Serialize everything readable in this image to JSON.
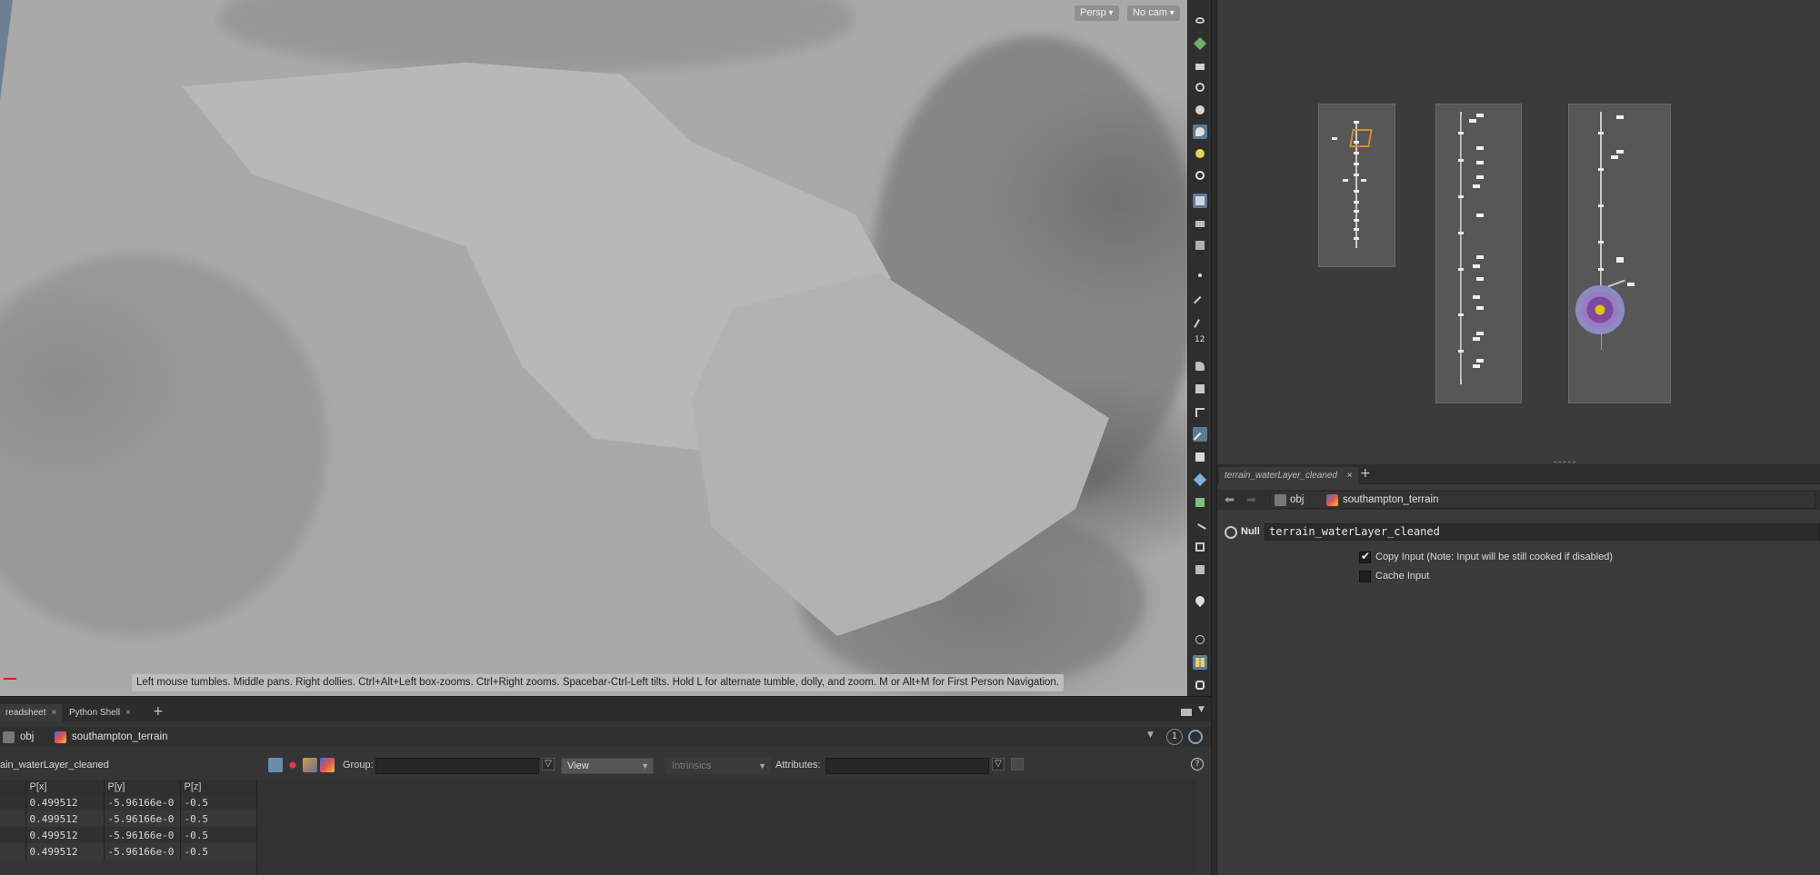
{
  "viewport": {
    "persp_label": "Persp",
    "cam_label": "No cam",
    "hint_text": "Left mouse tumbles. Middle pans. Right dollies. Ctrl+Alt+Left box-zooms. Ctrl+Right zooms. Spacebar-Ctrl-Left tilts. Hold L for alternate tumble, dolly, and zoom.    M or Alt+M for First Person Navigation.",
    "toolbar_icons": [
      "eye-icon",
      "geo-icon",
      "lock-icon",
      "snap-icon",
      "sphere-icon",
      "view-icon",
      "light-icon",
      "light-alt-icon",
      "vis-icon",
      "camera-icon",
      "render-icon",
      "lattice-icon",
      "point-icon",
      "edge-icon",
      "brush-icon",
      "number-icon",
      "paint-icon",
      "stamp-icon",
      "curve-icon",
      "select-icon",
      "texture-icon",
      "material-icon",
      "ground-icon",
      "bone-icon",
      "wire-icon",
      "store-icon",
      "flipbook-icon",
      "pin-icon",
      "info-icon",
      "layout-icon",
      "display-icon"
    ],
    "number_badge": "12"
  },
  "network": {
    "boxes": [
      "network-box-left",
      "network-box-middle",
      "network-box-right"
    ]
  },
  "param": {
    "tab_label": "terrain_waterLayer_cleaned",
    "tab_close": "×",
    "tab_add": "+",
    "path_obj": "obj",
    "path_node": "southampton_terrain",
    "node_type": "Null",
    "node_name": "terrain_waterLayer_cleaned",
    "copy_input_label": "Copy Input (Note: Input will be still cooked if disabled)",
    "copy_input_checked": true,
    "cache_input_label": "Cache Input",
    "cache_input_checked": false
  },
  "bottom": {
    "tabs": [
      {
        "label": "readsheet",
        "close": "×"
      },
      {
        "label": "Python Shell",
        "close": "×"
      }
    ],
    "tab_add": "+",
    "path_obj": "obj",
    "path_node": "southampton_terrain",
    "path_badge": "1",
    "node_label": "ain_waterLayer_cleaned",
    "group_label": "Group:",
    "view_label": "View",
    "intrinsics_label": "Intrinsics",
    "attributes_label": "Attributes:",
    "help_label": "?",
    "columns": [
      "P[x]",
      "P[y]",
      "P[z]"
    ],
    "rows": [
      [
        "0.499512",
        "-5.96166e-0",
        "-0.5"
      ],
      [
        "0.499512",
        "-5.96166e-0",
        "-0.5"
      ],
      [
        "0.499512",
        "-5.96166e-0",
        "-0.5"
      ],
      [
        "0.499512",
        "-5.96166e-0",
        "-0.5"
      ]
    ]
  },
  "colors": {
    "viewport_bg": "#a9a9a9",
    "panel_bg": "#3a3a3a",
    "toolbar_bg": "#2e2e2e",
    "accent": "#5d7a92",
    "network_link": "#6fb3a8",
    "selected_node": "#e6c400"
  }
}
